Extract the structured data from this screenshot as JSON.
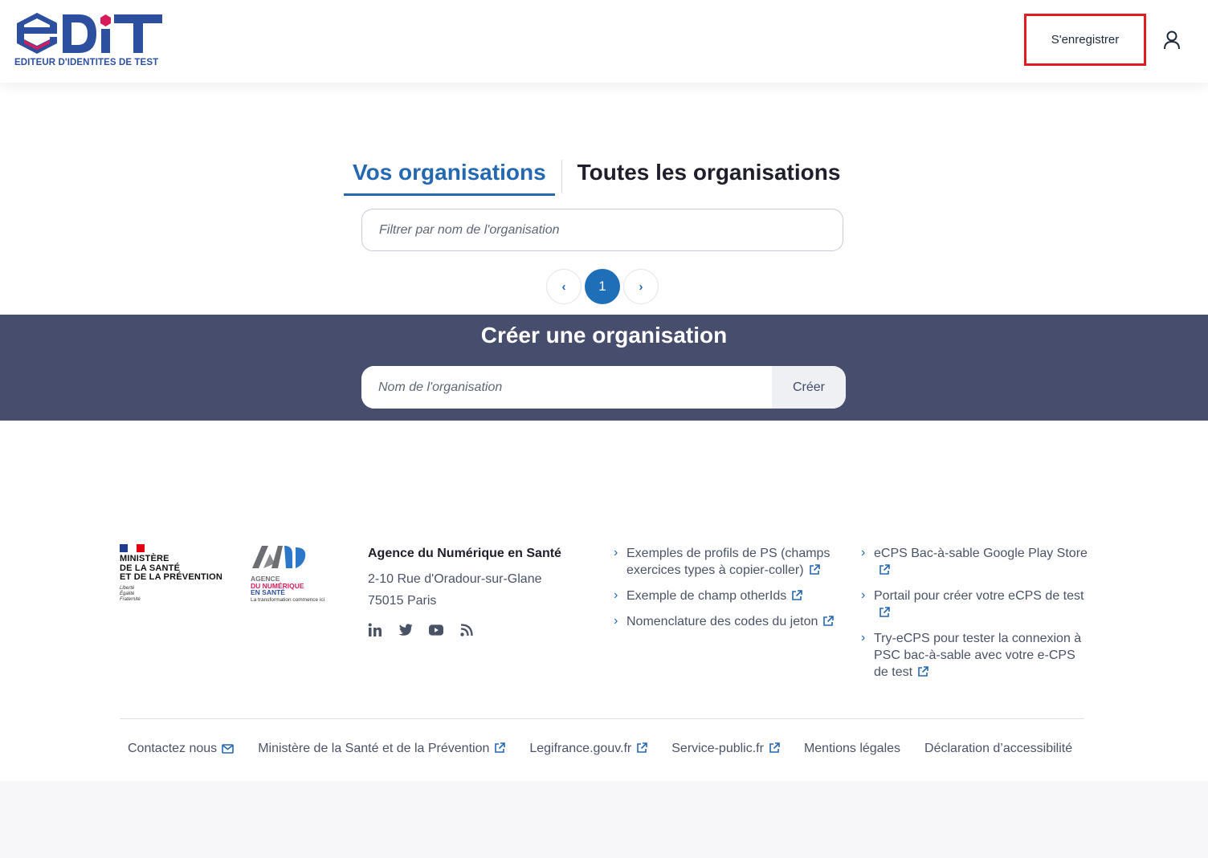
{
  "header": {
    "logo_text": "eDiT",
    "logo_subtitle": "EDITEUR D'IDENTITES DE TEST",
    "register_label": "S'enregistrer",
    "user_icon": "user-icon"
  },
  "tabs": [
    {
      "label": "Vos organisations",
      "active": true
    },
    {
      "label": "Toutes les organisations",
      "active": false
    }
  ],
  "filter": {
    "placeholder": "Filtrer par nom de l'organisation",
    "value": ""
  },
  "pagination": {
    "prev": "‹",
    "current": "1",
    "next": "›"
  },
  "create": {
    "title": "Créer une organisation",
    "placeholder": "Nom de l'organisation",
    "button": "Créer"
  },
  "footer": {
    "ministry": {
      "name_lines": [
        "MINISTÈRE",
        "DE LA SANTÉ",
        "ET DE LA PRÉVENTION"
      ],
      "motto": [
        "Liberté",
        "Égalité",
        "Fraternité"
      ]
    },
    "ans": {
      "lines": [
        "AGENCE",
        "DU NUMÉRIQUE",
        "EN SANTÉ"
      ],
      "tagline": "La transformation commence ici"
    },
    "agency": {
      "name": "Agence du Numérique en Santé",
      "address1": "2-10 Rue d'Oradour-sur-Glane",
      "address2": "75015 Paris"
    },
    "socials": [
      "linkedin-icon",
      "twitter-icon",
      "youtube-icon",
      "rss-icon"
    ],
    "links_col1": [
      "Exemples de profils de PS (champs exercices types à copier-coller)",
      "Exemple de champ otherIds",
      "Nomenclature des codes du jeton"
    ],
    "links_col2": [
      "eCPS Bac-à-sable Google Play Store",
      "Portail pour créer votre eCPS de test",
      "Try-eCPS pour tester la connexion à PSC bac-à-sable avec votre e-CPS de test"
    ],
    "bottom_links": [
      "Contactez nous",
      "Ministère de la Santé et de la Prévention",
      "Legifrance.gouv.fr",
      "Service-public.fr",
      "Mentions légales",
      "Déclaration d’accessibilité"
    ]
  },
  "colors": {
    "primary": "#2467b2",
    "band": "#474d6d",
    "highlight": "#e01b22"
  }
}
